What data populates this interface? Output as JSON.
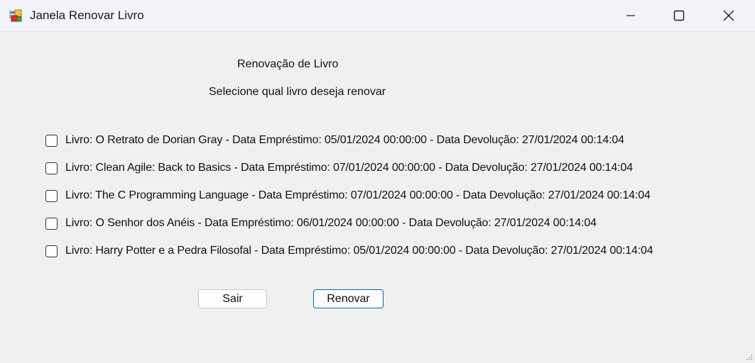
{
  "window": {
    "title": "Janela Renovar Livro",
    "icons": [
      "app-icon",
      "minimize-icon",
      "maximize-icon",
      "close-icon"
    ]
  },
  "header": {
    "title": "Renovação de Livro",
    "subtitle": "Selecione qual livro deseja renovar"
  },
  "books": [
    {
      "label": "Livro: O Retrato de Dorian Gray - Data Empréstimo: 05/01/2024 00:00:00 - Data Devolução: 27/01/2024 00:14:04",
      "checked": false
    },
    {
      "label": "Livro: Clean Agile: Back to Basics - Data Empréstimo: 07/01/2024 00:00:00 - Data Devolução: 27/01/2024 00:14:04",
      "checked": false
    },
    {
      "label": "Livro: The C Programming Language - Data Empréstimo: 07/01/2024 00:00:00 - Data Devolução: 27/01/2024 00:14:04",
      "checked": false
    },
    {
      "label": "Livro: O Senhor dos Anéis - Data Empréstimo: 06/01/2024 00:00:00 - Data Devolução: 27/01/2024 00:14:04",
      "checked": false
    },
    {
      "label": "Livro: Harry Potter e a Pedra Filosofal - Data Empréstimo: 05/01/2024 00:00:00 - Data Devolução: 27/01/2024 00:14:04",
      "checked": false
    }
  ],
  "buttons": {
    "exit_label": "Sair",
    "renew_label": "Renovar"
  },
  "colors": {
    "accent": "#0067c0",
    "titlebar": "#f3f4f9",
    "form": "#f0f0f0"
  }
}
